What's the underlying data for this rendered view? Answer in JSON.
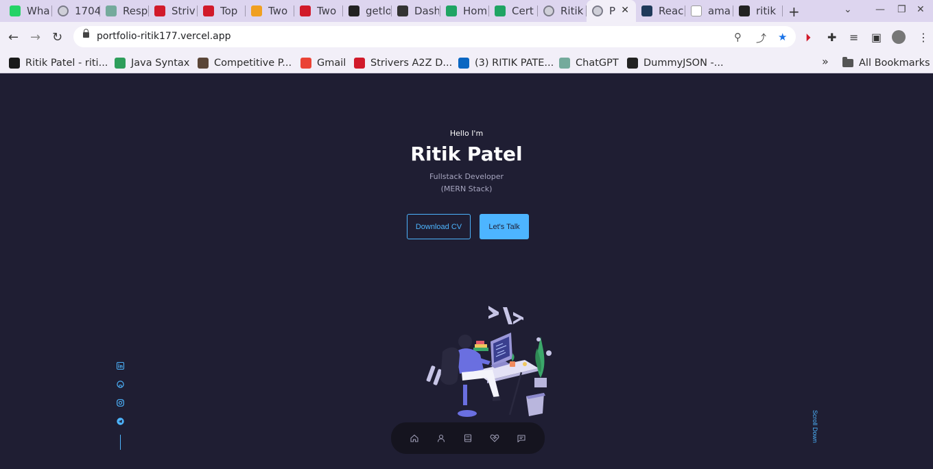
{
  "browser": {
    "tabs": [
      {
        "title": "Wha",
        "icon": "whatsapp-icon",
        "color": "#25d366"
      },
      {
        "title": "1704",
        "icon": "globe-icon",
        "color": "#8a8a99"
      },
      {
        "title": "Resp",
        "icon": "chatgpt-icon",
        "color": "#74aa9c"
      },
      {
        "title": "Striv",
        "icon": "tuf-icon",
        "color": "#d11a2a"
      },
      {
        "title": "Top",
        "icon": "tuf-icon",
        "color": "#d11a2a"
      },
      {
        "title": "Two",
        "icon": "leetcode-icon",
        "color": "#f0a020"
      },
      {
        "title": "Two",
        "icon": "tuf-icon",
        "color": "#d11a2a"
      },
      {
        "title": "getlo",
        "icon": "github-icon",
        "color": "#222222"
      },
      {
        "title": "Dash",
        "icon": "dashboard-icon",
        "color": "#333333"
      },
      {
        "title": "Hom",
        "icon": "drive-icon",
        "color": "#1fa463"
      },
      {
        "title": "Cert",
        "icon": "drive-icon",
        "color": "#1fa463"
      },
      {
        "title": "Ritik",
        "icon": "globe-icon",
        "color": "#8a8a99"
      },
      {
        "title": "P",
        "icon": "globe-icon",
        "color": "#8a8a99",
        "active": true
      },
      {
        "title": "Reac",
        "icon": "react-icon",
        "color": "#1f3a5a"
      },
      {
        "title": "ama",
        "icon": "amazon-icon",
        "color": "#ffffff"
      },
      {
        "title": "ritik",
        "icon": "github-icon",
        "color": "#222222"
      }
    ],
    "url": "portfolio-ritik177.vercel.app",
    "bookmarks": [
      {
        "label": "Ritik Patel - riti...",
        "icon": "nj-icon",
        "color": "#1a1a1a"
      },
      {
        "label": "Java Syntax",
        "icon": "w-icon",
        "color": "#2e9e5b"
      },
      {
        "label": "Competitive P...",
        "icon": "cc-icon",
        "color": "#5b4638"
      },
      {
        "label": "Gmail",
        "icon": "gmail-icon",
        "color": "#ea4335"
      },
      {
        "label": "Strivers A2Z D...",
        "icon": "tuf-icon",
        "color": "#d11a2a"
      },
      {
        "label": "(3) RITIK PATE...",
        "icon": "linkedin-icon",
        "color": "#0a66c2"
      },
      {
        "label": "ChatGPT",
        "icon": "chatgpt-icon",
        "color": "#74aa9c"
      },
      {
        "label": "DummyJSON -...",
        "icon": "dummyjson-icon",
        "color": "#222222"
      }
    ],
    "all_bookmarks": "All Bookmarks"
  },
  "hero": {
    "greeting": "Hello I'm",
    "name": "Ritik Patel",
    "role": "Fullstack Developer",
    "stack": "(MERN Stack)",
    "download_cv": "Download CV",
    "lets_talk": "Let's Talk",
    "scroll_down": "Scroll Down"
  },
  "colors": {
    "background": "#1f1e33",
    "accent": "#4db5ff",
    "nav_bg": "#15141f"
  }
}
